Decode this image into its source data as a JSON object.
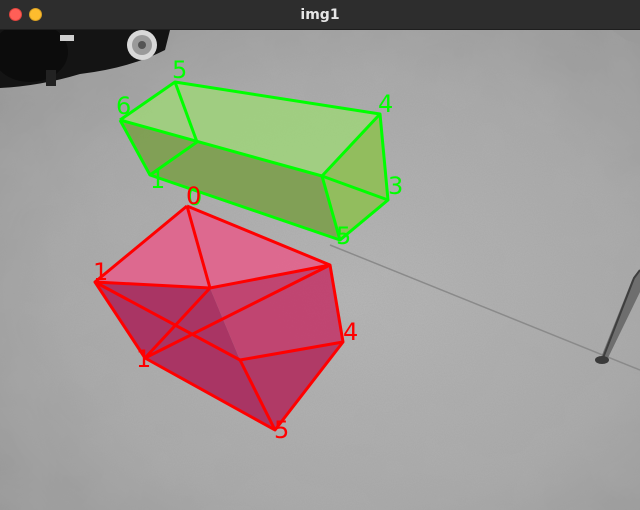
{
  "window": {
    "title": "img1"
  },
  "controls": {
    "close_color": "#ff5f57",
    "minimize_color": "#febc2e"
  },
  "annotations": {
    "green_box": {
      "color": "#00ff00",
      "labels": [
        "5",
        "6",
        "4",
        "3",
        "1",
        "0",
        "5"
      ]
    },
    "red_box": {
      "color": "#ff0000",
      "labels": [
        "0",
        "1",
        "4",
        "1",
        "5"
      ]
    }
  }
}
